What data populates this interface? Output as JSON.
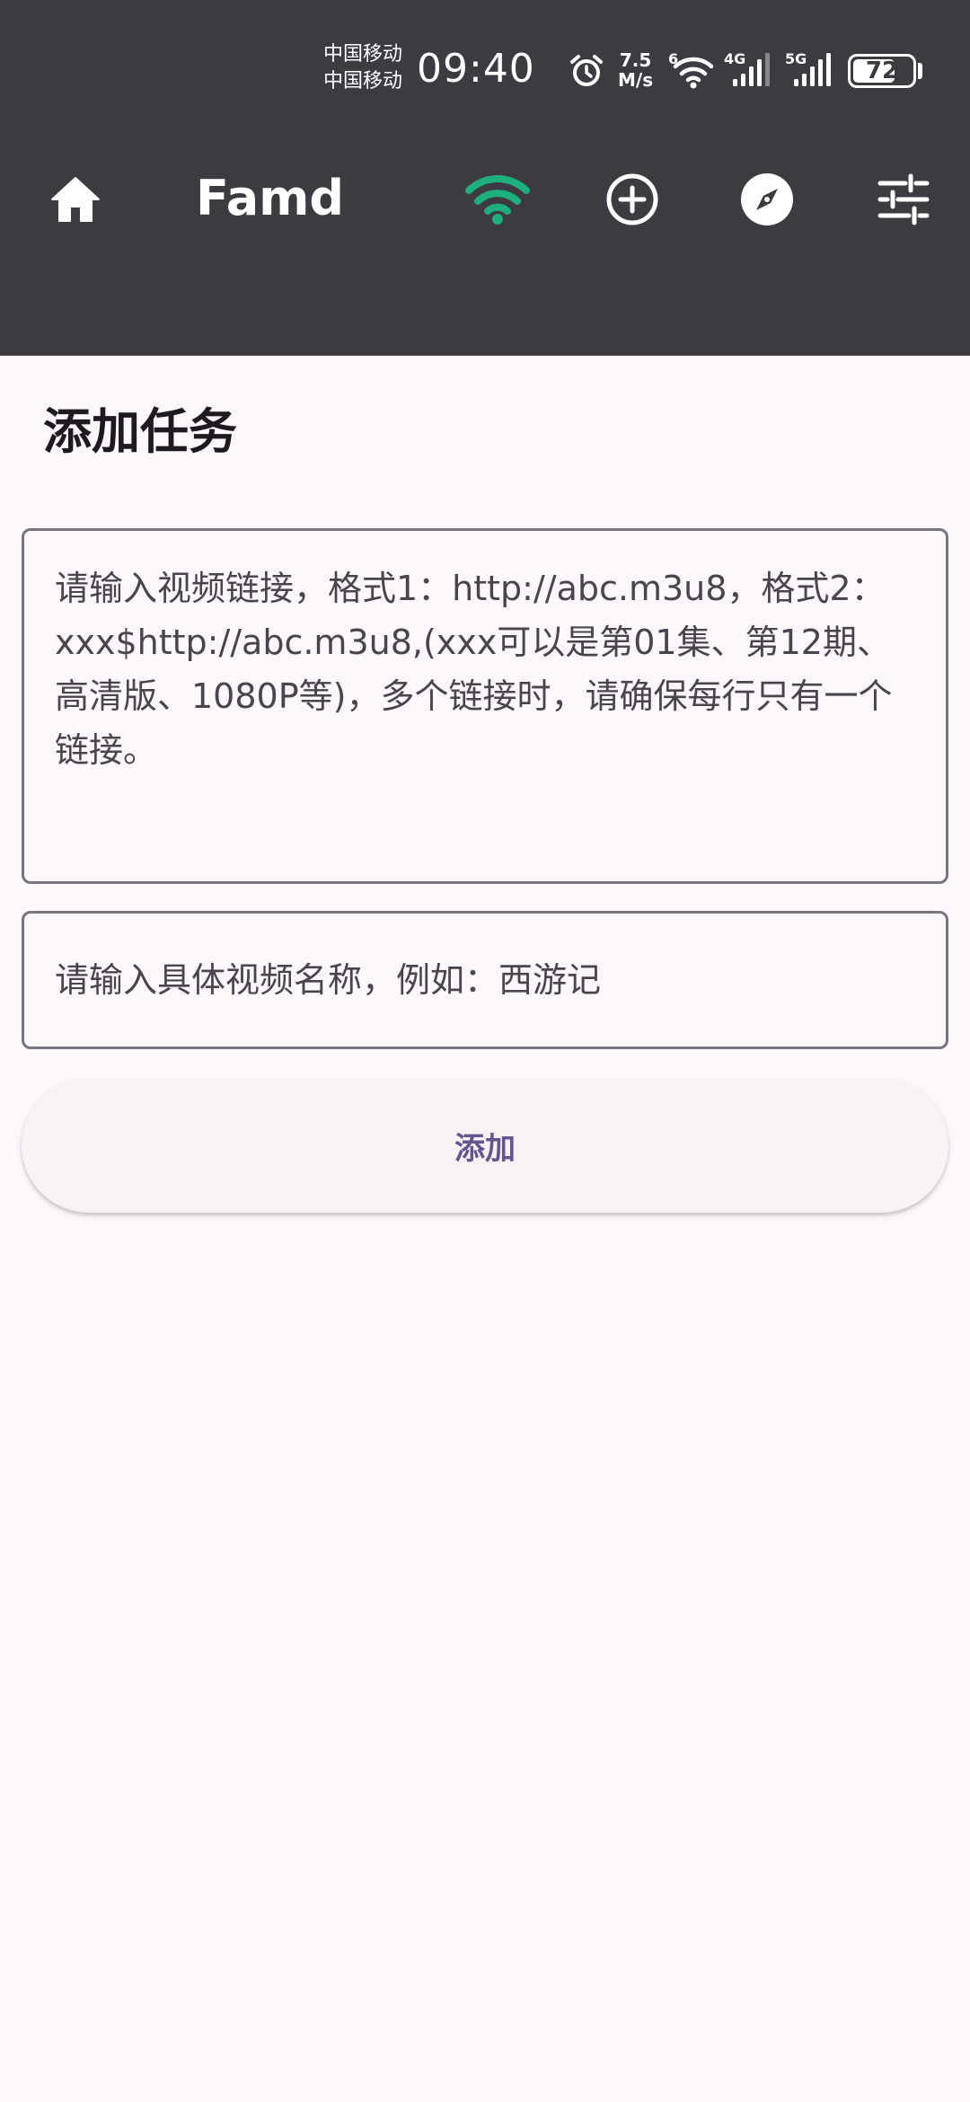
{
  "status_bar": {
    "carrier_1": "中国移动",
    "carrier_2": "中国移动",
    "time": "09:40",
    "speed_value": "7.5",
    "speed_unit": "M/s",
    "wifi_badge": "6",
    "net_1": "4G",
    "net_2": "5G",
    "battery": "72",
    "battery_level": 0.72
  },
  "app_bar": {
    "title": "Famd",
    "icons": [
      "home-icon",
      "wifi-icon",
      "add-circle-icon",
      "compass-icon",
      "tune-icon"
    ],
    "wifi_color": "#1DB07E"
  },
  "page": {
    "title": "添加任务"
  },
  "form": {
    "url_placeholder": "请输入视频链接，格式1：http://abc.m3u8，格式2：xxx$http://abc.m3u8,(xxx可以是第01集、第12期、高清版、1080P等)，多个链接时，请确保每行只有一个链接。",
    "name_placeholder": "请输入具体视频名称，例如：西游记",
    "add_label": "添加"
  },
  "colors": {
    "app_bar_bg": "#3E3A42",
    "page_bg": "#FDF7FC",
    "accent": "#65558F",
    "outline": "#79747E"
  }
}
